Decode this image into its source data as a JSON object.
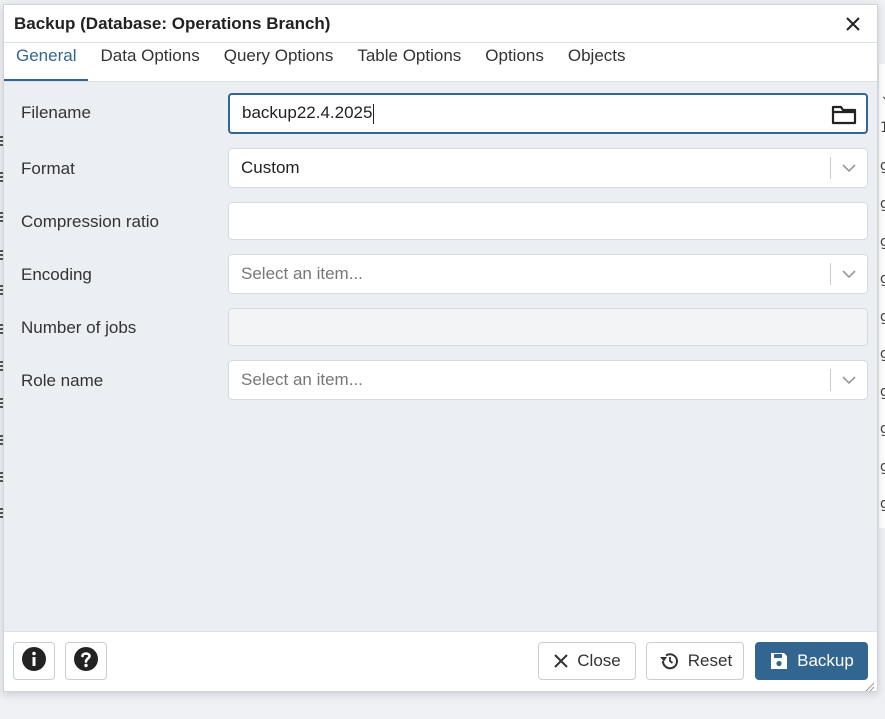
{
  "dialog": {
    "title": "Backup (Database: Operations Branch)",
    "close_icon": "close-icon"
  },
  "tabs": [
    {
      "label": "General",
      "active": true
    },
    {
      "label": "Data Options",
      "active": false
    },
    {
      "label": "Query Options",
      "active": false
    },
    {
      "label": "Table Options",
      "active": false
    },
    {
      "label": "Options",
      "active": false
    },
    {
      "label": "Objects",
      "active": false
    }
  ],
  "form": {
    "filename": {
      "label": "Filename",
      "value": "backup22.4.2025",
      "icon": "folder-icon"
    },
    "format": {
      "label": "Format",
      "value": "Custom"
    },
    "compression": {
      "label": "Compression ratio",
      "value": ""
    },
    "encoding": {
      "label": "Encoding",
      "placeholder": "Select an item..."
    },
    "jobs": {
      "label": "Number of jobs",
      "value": ""
    },
    "role": {
      "label": "Role name",
      "placeholder": "Select an item..."
    }
  },
  "footer": {
    "info_icon": "info-icon",
    "help_icon": "help-icon",
    "close_label": "Close",
    "reset_label": "Reset",
    "backup_label": "Backup"
  },
  "colors": {
    "accent": "#326690",
    "dialog_bg": "#ebeef2"
  },
  "background_glyphs": [
    "⌄",
    "1",
    "g",
    "g",
    "g",
    "g",
    "g",
    "g",
    "g",
    "g",
    "g",
    "g"
  ]
}
